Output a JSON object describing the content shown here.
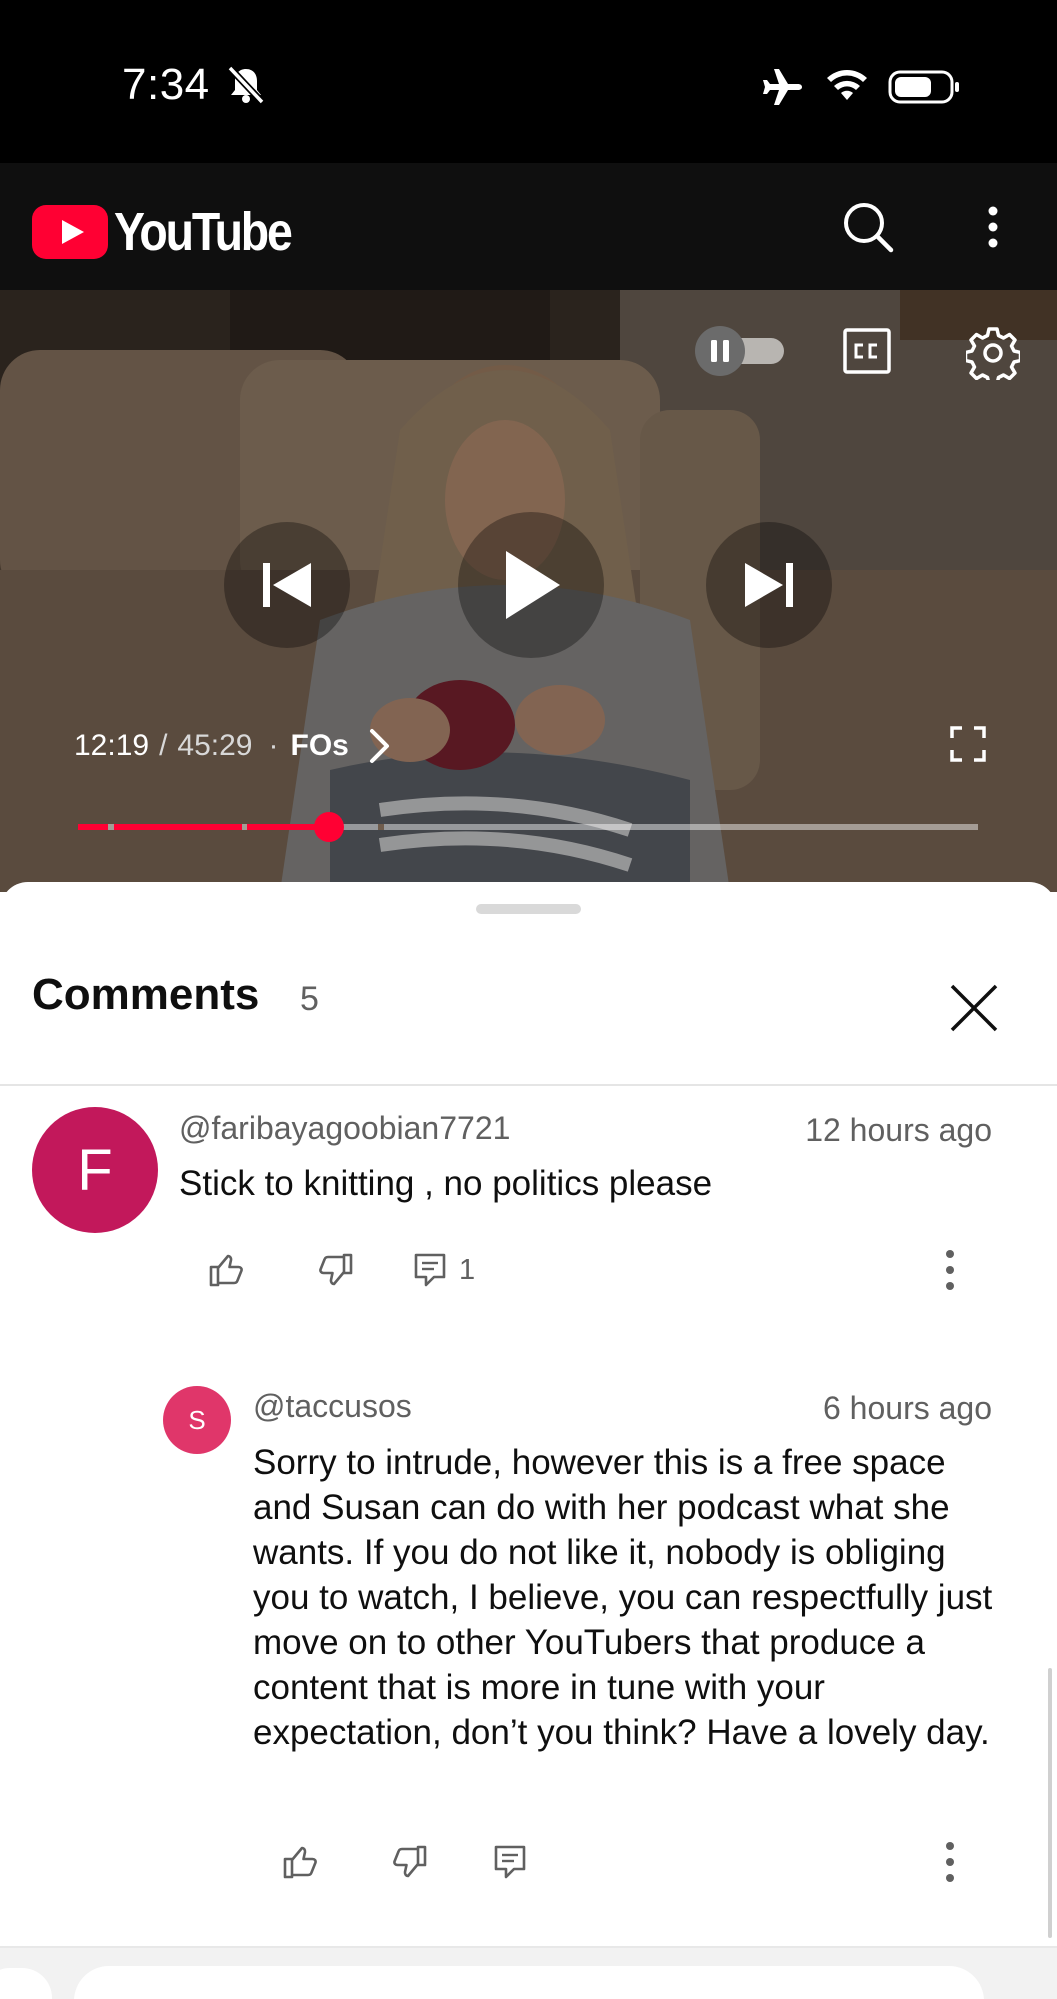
{
  "status_bar": {
    "time": "7:34",
    "icons": [
      "bell-off-icon",
      "airplane-icon",
      "wifi-icon",
      "battery-icon"
    ]
  },
  "app_bar": {
    "logo_text": "YouTube",
    "brand_color": "#ff0033",
    "icons": [
      "search-icon",
      "more-vert-icon"
    ]
  },
  "player": {
    "current_time": "12:19",
    "separator": "/",
    "duration": "45:29",
    "chapter_dot": "·",
    "chapter": "FOs",
    "progress_fraction": 0.27,
    "autoplay_state": "paused",
    "icons": [
      "autoplay-toggle-icon",
      "captions-icon",
      "settings-icon",
      "previous-icon",
      "play-icon",
      "next-icon",
      "fullscreen-icon",
      "chevron-right-icon"
    ]
  },
  "comments": {
    "title": "Comments",
    "count": "5",
    "items": [
      {
        "avatar_letter": "F",
        "avatar_color": "#c2185b",
        "handle": "@faribayagoobian7721",
        "time_ago": "12 hours ago",
        "text": "Stick to knitting , no politics please",
        "reply_count": "1"
      },
      {
        "avatar_letter": "S",
        "avatar_color": "#e0366a",
        "handle": "@taccusos",
        "time_ago": "6 hours ago",
        "text": "Sorry to intrude, however this is a free space and Susan can do with her podcast what she wants. If you do not like it, nobody is obliging you to watch, I believe, you can respectfully just move on to other YouTubers that produce a content that is more in tune with your expectation, don’t you think? Have a lovely day."
      }
    ]
  }
}
